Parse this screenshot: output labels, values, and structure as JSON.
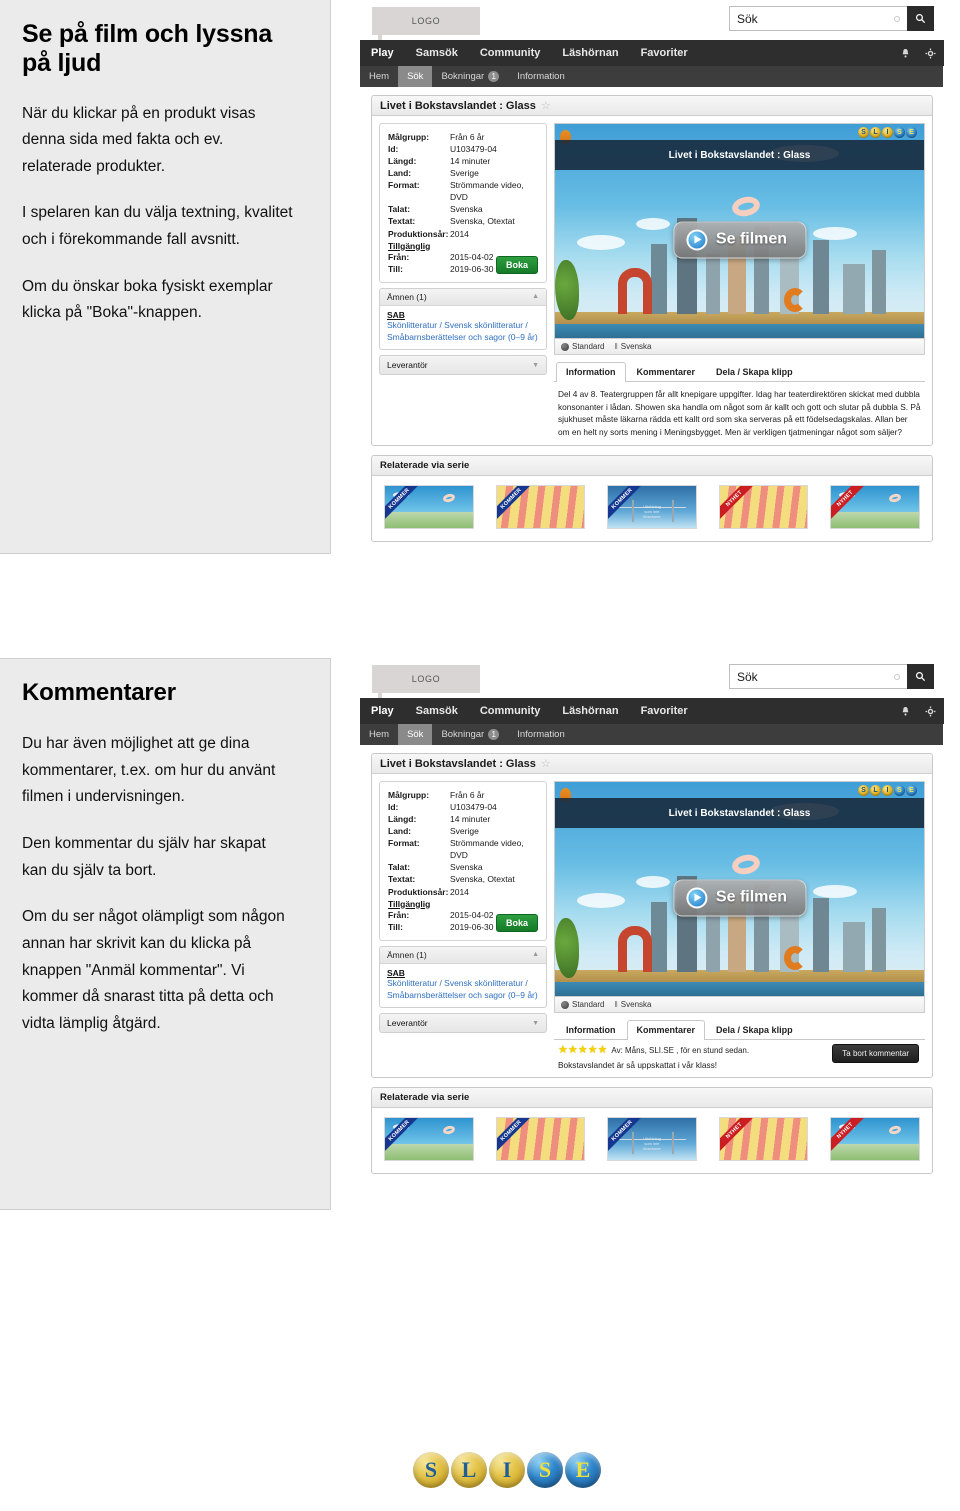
{
  "sections": [
    {
      "title": "Se på film och lyssna på ljud",
      "paragraphs": [
        "När du klickar på en produkt visas denna sida med fakta och ev. relaterade produkter.",
        "I spelaren kan du välja textning, kvalitet och i förekommande fall avsnitt.",
        "Om du önskar boka fysiskt exemplar klicka på \"Boka\"-knappen."
      ]
    },
    {
      "title": "Kommentarer",
      "paragraphs": [
        "Du har även möjlighet att ge dina kommentarer, t.ex. om hur du använt filmen i undervisningen.",
        "Den kommentar du själv har skapat kan du själv ta bort.",
        "Om du ser något olämpligt som någon annan har skrivit kan du klicka på knappen \"Anmäl kommentar\". Vi kommer då snarast titta på detta och vidta lämplig åtgärd."
      ]
    }
  ],
  "app": {
    "logo_label": "LOGO",
    "search": {
      "placeholder": "Sök",
      "value": "Sök",
      "icon": "search-icon"
    },
    "nav_icons": [
      {
        "name": "bell-icon"
      },
      {
        "name": "gear-icon"
      }
    ],
    "main_nav": [
      {
        "label": "Play",
        "active": true
      },
      {
        "label": "Samsök",
        "active": false
      },
      {
        "label": "Community",
        "active": false
      },
      {
        "label": "Läshörnan",
        "active": false
      },
      {
        "label": "Favoriter",
        "active": false
      }
    ],
    "sub_nav": [
      {
        "label": "Hem",
        "active": false,
        "badge": ""
      },
      {
        "label": "Sök",
        "active": true,
        "badge": ""
      },
      {
        "label": "Bokningar",
        "active": false,
        "badge": "1"
      },
      {
        "label": "Information",
        "active": false,
        "badge": ""
      }
    ],
    "card_title": "Livet i Bokstavslandet : Glass",
    "favorite_icon": "star-outline-icon",
    "metadata": [
      {
        "key": "Målgrupp:",
        "value": "Från 6 år"
      },
      {
        "key": "Id:",
        "value": "U103479-04"
      },
      {
        "key": "Längd:",
        "value": "14 minuter"
      },
      {
        "key": "Land:",
        "value": "Sverige"
      },
      {
        "key": "Format:",
        "value": "Strömmande video, DVD"
      },
      {
        "key": "Talat:",
        "value": "Svenska"
      },
      {
        "key": "Textat:",
        "value": "Svenska, Otextat"
      },
      {
        "key": "Produktionsår:",
        "value": "2014"
      }
    ],
    "availability_heading": "Tillgänglig",
    "availability": [
      {
        "key": "Från:",
        "value": "2015-04-02"
      },
      {
        "key": "Till:",
        "value": "2019-06-30"
      }
    ],
    "boka_label": "Boka",
    "subjects_header": "Ämnen (1)",
    "subjects_code": "SAB",
    "subjects_link": "Skönlitteratur / Svensk skönlitteratur / Småbarnsberättelser och sagor (0–9 år)",
    "supplier_header": "Leverantör",
    "player": {
      "overlay_title": "Livet i Bokstavslandet : Glass",
      "play_label": "Se filmen",
      "brand": "SLISE",
      "controls": [
        {
          "label": "Standard",
          "icon": "quality-icon"
        },
        {
          "label": "Svenska",
          "icon": "subtitles-icon"
        }
      ]
    },
    "tabs": [
      {
        "label": "Information"
      },
      {
        "label": "Kommentarer"
      },
      {
        "label": "Dela / Skapa klipp"
      }
    ],
    "description": "Del 4 av 8. Teatergruppen får allt knepigare uppgifter. Idag har teaterdirektören skickat med dubbla konsonanter i lådan. Showen ska handla om något som är kallt och gott och slutar på dubbla S. På sjukhuset måste läkarna rädda ett kallt ord som ska serveras på ett födelsedagskalas. Allan ber om en helt ny sorts mening i Meningsbygget. Men är verkligen tjatmeningar något som säljer?",
    "comment": {
      "stars": 5,
      "star_color": "#f5d300",
      "byline": "Av: Måns, SLI.SE , för en stund sedan.",
      "text": "Bokstavslandet är så uppskattat i vår klass!",
      "delete_label": "Ta bort kommentar"
    },
    "related_header": "Relaterade via serie",
    "related_items": [
      {
        "ribbon": "KOMMER",
        "ribbon_color": "#15378f",
        "style": "city"
      },
      {
        "ribbon": "KOMMER",
        "ribbon_color": "#15378f",
        "style": "stripe"
      },
      {
        "ribbon": "KOMMER",
        "ribbon_color": "#15378f",
        "style": "pole"
      },
      {
        "ribbon": "NYHET",
        "ribbon_color": "#cc1d22",
        "style": "stripe"
      },
      {
        "ribbon": "NYHET",
        "ribbon_color": "#cc1d22",
        "style": "city"
      }
    ]
  },
  "shot_one": {
    "active_tab": "Information"
  },
  "shot_two": {
    "active_tab": "Kommentarer"
  },
  "footer_logo": {
    "letters": [
      {
        "ch": "S",
        "tone": "gold"
      },
      {
        "ch": "L",
        "tone": "gold"
      },
      {
        "ch": "I",
        "tone": "gold"
      },
      {
        "ch": "S",
        "tone": "blue"
      },
      {
        "ch": "E",
        "tone": "blue"
      }
    ]
  }
}
